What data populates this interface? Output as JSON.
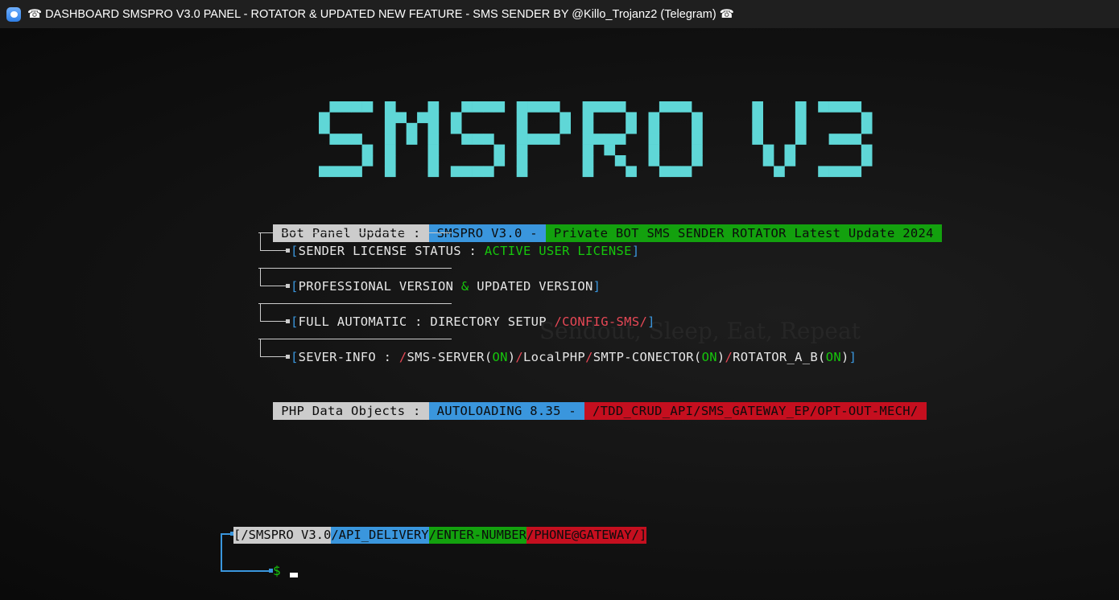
{
  "window": {
    "title": "☎ DASHBOARD SMSPRO V3.0 PANEL - ROTATOR & UPDATED NEW FEATURE - SMS SENDER BY @Killo_Trojanz2 (Telegram) ☎"
  },
  "logo": {
    "text": "SMSPRO V3",
    "color": "#5fd7d7"
  },
  "watermark": "Sendout, Sleep, Eat, Repeat",
  "header_bar": {
    "label": "Bot Panel Update :",
    "version": "SMSPRO V3.0 -",
    "description": "Private BOT SMS SENDER ROTATOR Latest Update 2024"
  },
  "items": [
    {
      "open": "[",
      "label": "SENDER LICENSE STATUS : ",
      "value": "ACTIVE USER LICENSE",
      "close": "]"
    },
    {
      "open": "[",
      "label1": "PROFESSIONAL VERSION ",
      "amp": "&",
      "label2": " UPDATED VERSION",
      "close": "]"
    },
    {
      "open": "[",
      "label": "FULL AUTOMATIC : DIRECTORY SETUP ",
      "value": "/CONFIG-SMS/",
      "close": "]"
    },
    {
      "open": "[",
      "label": "SEVER-INFO : ",
      "s1": "/",
      "t1": "SMS-SERVER(",
      "on1": "ON",
      "p1": ")",
      "s2": "/",
      "t2": "LocalPHP",
      "s3": "/",
      "t3": "SMTP-CONECTOR(",
      "on2": "ON",
      "p2": ")",
      "s4": "/",
      "t4": "ROTATOR_A_B(",
      "on3": "ON",
      "p3": ")",
      "close": "]"
    }
  ],
  "footer_bar": {
    "label": "PHP Data Objects :",
    "version": "AUTOLOADING 8.35 -",
    "path": "/TDD_CRUD_API/SMS_GATEWAY_EP/OPT-OUT-MECH/"
  },
  "prompt": {
    "seg1": "[/SMSPRO V3.0",
    "seg2": "/API_DELIVERY",
    "seg3": "/ENTER-NUMBER",
    "seg4": "/PHONE@GATEWAY/]",
    "symbol": "$"
  }
}
